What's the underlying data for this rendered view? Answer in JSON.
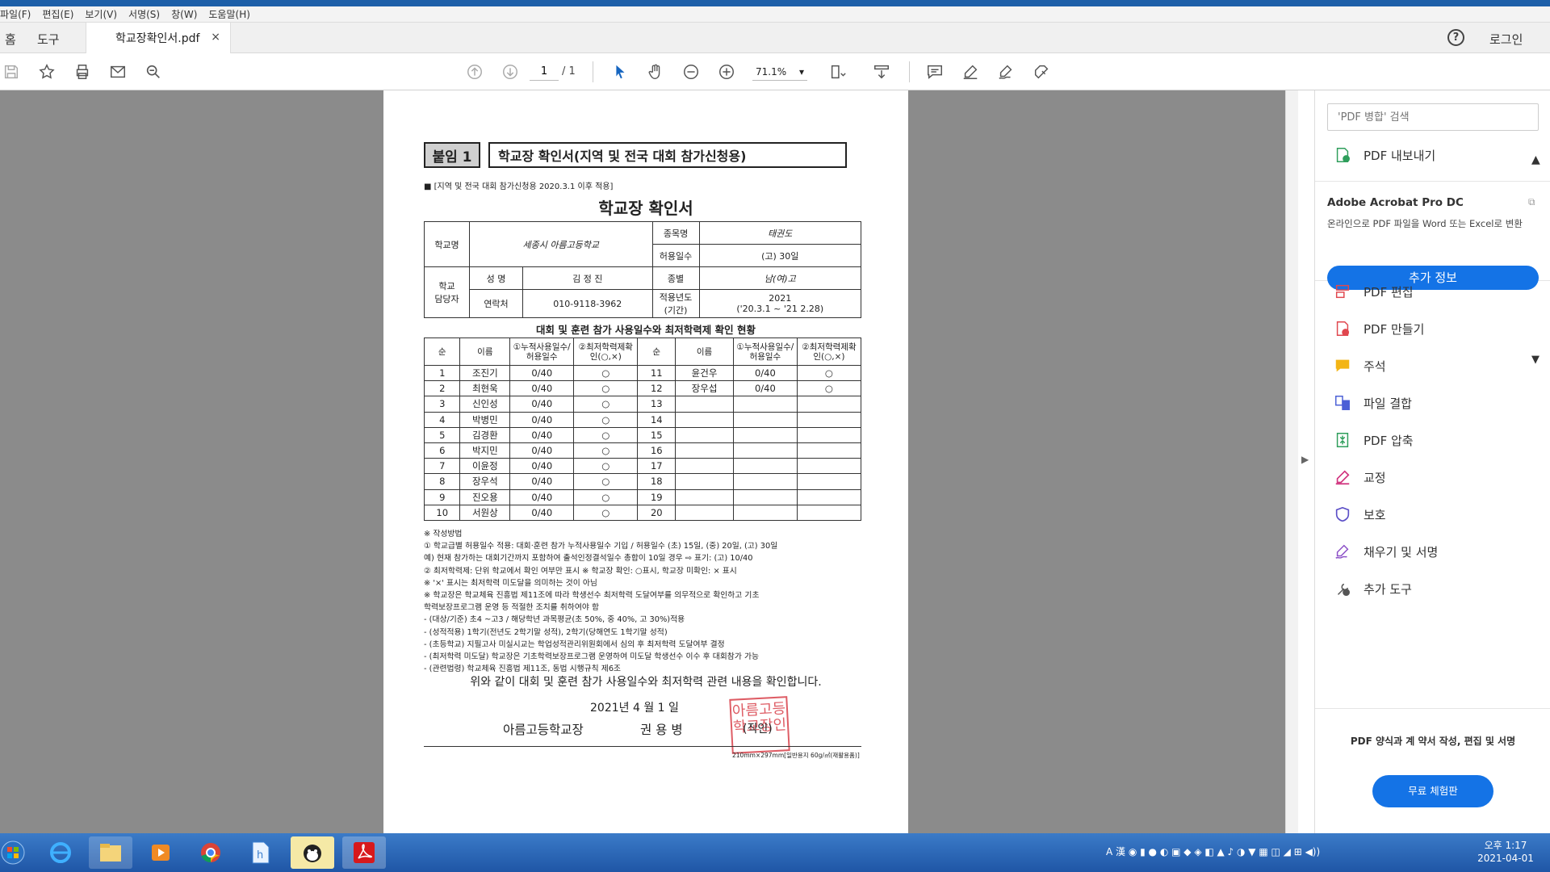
{
  "menu": [
    "파일(F)",
    "편집(E)",
    "보기(V)",
    "서명(S)",
    "창(W)",
    "도움말(H)"
  ],
  "tabs": {
    "home": "홈",
    "tools": "도구",
    "document": "학교장확인서.pdf",
    "close": "×"
  },
  "header": {
    "help": "?",
    "login": "로그인"
  },
  "toolbar": {
    "page_current": "1",
    "page_total": "/ 1",
    "zoom": "71.1%"
  },
  "document": {
    "tag": "붙임 1",
    "title_box": "학교장 확인서(지역 및 전국 대회 참가신청용)",
    "apply_note": "■ [지역 및 전국 대회 참가신청용 2020.3.1 이후 적용]",
    "form_title": "학교장 확인서",
    "info": {
      "school_label": "학교명",
      "school_value": "세종시 아름고등학교",
      "event_label": "종목명",
      "event_value": "태권도",
      "allowed_label": "허용일수",
      "allowed_value": "(고) 30일",
      "staff_label1": "학교",
      "staff_label2": "담당자",
      "name_label": "성 명",
      "name_value": "김 정 진",
      "gender_label": "종별",
      "gender_value": "남(여)고",
      "contact_label": "연락처",
      "contact_value": "010-9118-3962",
      "year_label1": "적용년도",
      "year_label2": "(기간)",
      "year_value1": "2021",
      "year_value2": "('20.3.1 ~ '21 2.28)"
    },
    "status_title": "대회 및 훈련 참가 사용일수와 최저학력제 확인 현황",
    "headers": [
      "순",
      "이름",
      "①누적사용일수/허용일수",
      "②최저학력제확인(○,×)",
      "순",
      "이름",
      "①누적사용일수/허용일수",
      "②최저학력제확인(○,×)"
    ],
    "rows": [
      [
        "1",
        "조진기",
        "0/40",
        "○",
        "11",
        "윤건우",
        "0/40",
        "○"
      ],
      [
        "2",
        "최현욱",
        "0/40",
        "○",
        "12",
        "장우섭",
        "0/40",
        "○"
      ],
      [
        "3",
        "신인성",
        "0/40",
        "○",
        "13",
        "",
        "",
        ""
      ],
      [
        "4",
        "박병민",
        "0/40",
        "○",
        "14",
        "",
        "",
        ""
      ],
      [
        "5",
        "김경환",
        "0/40",
        "○",
        "15",
        "",
        "",
        ""
      ],
      [
        "6",
        "박지민",
        "0/40",
        "○",
        "16",
        "",
        "",
        ""
      ],
      [
        "7",
        "이윤정",
        "0/40",
        "○",
        "17",
        "",
        "",
        ""
      ],
      [
        "8",
        "장우석",
        "0/40",
        "○",
        "18",
        "",
        "",
        ""
      ],
      [
        "9",
        "진오용",
        "0/40",
        "○",
        "19",
        "",
        "",
        ""
      ],
      [
        "10",
        "서원상",
        "0/40",
        "○",
        "20",
        "",
        "",
        ""
      ]
    ],
    "notes": [
      "※ 작성방법",
      "① 학교급별 허용일수 적용: 대회·훈련 참가 누적사용일수 기입 / 허용일수 (초) 15일, (중) 20일, (고) 30일",
      "    예) 현재 참가하는 대회기간까지 포함하여 출석인정결석일수 총합이 10일 경우 ⇨ 표기: (고) 10/40",
      "② 최저학력제: 단위 학교에서 확인 여부만 표시 ※ 학교장 확인: ○표시, 학교장 미확인: × 표시",
      "    ※ '×' 표시는 최저학력 미도달을 의미하는 것이 아님",
      "    ※ 학교장은 학교체육 진흥법 제11조에 따라 학생선수 최저학력 도달여부를 의무적으로 확인하고  기초",
      "        학력보장프로그램 운영 등 적절한 조치를 취하여야 함",
      " - (대상/기준) 초4 ~고3 / 해당학년 과목평균(초 50%, 중 40%, 고 30%)적용",
      " - (성적적용) 1학기(전년도 2학기말 성적), 2학기(당해연도 1학기말 성적)",
      " - (초등학교) 지필고사 미실시교는 학업성적관리위원회에서 심의 후 최저학력 도달여부 결정",
      " - (최저학력 미도달) 학교장은 기초학력보장프로그램 운영하여 미도달 학생선수 이수 후 대회참가 가능",
      " - (관련법령) 학교체육 진흥법 제11조, 동법 시행규칙 제6조"
    ],
    "confirm_text": "위와 같이 대회 및 훈련 참가 사용일수와 최저학력 관련 내용을 확인합니다.",
    "date_text": "2021년  4  월  1  일",
    "principal_label": "아름고등학교장",
    "principal_name": "권  용  병",
    "seal_label": "(직인)",
    "seal_text": "아름고등학교장인",
    "footnote": "210mm×297mm[일반용지 60g/㎡(재활용품)]"
  },
  "rpanel": {
    "search_placeholder": "'PDF 병합' 검색",
    "export": "PDF 내보내기",
    "product": "Adobe Acrobat Pro DC",
    "product_desc": "온라인으로 PDF 파일을 Word 또는 Excel로 변환",
    "more_info": "추가 정보",
    "tools": [
      "PDF 편집",
      "PDF 만들기",
      "주석",
      "파일 결합",
      "PDF 압축",
      "교정",
      "보호",
      "채우기 및 서명",
      "추가 도구"
    ],
    "promo": "PDF 양식과 계 약서 작성, 편집 및 서명",
    "trial": "무료 체험판"
  },
  "taskbar": {
    "time": "오후 1:17",
    "date": "2021-04-01",
    "ime": "A 漢"
  },
  "colors": {
    "accent": "#1473e6",
    "seal": "#d9414b",
    "canvas": "#8b8b8b"
  }
}
